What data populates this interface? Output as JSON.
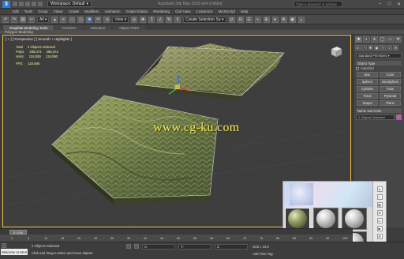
{
  "titlebar": {
    "app_logo": "3",
    "workspace_label": "Workspace: Default",
    "document_title": "Autodesk 3ds Max  2015 x64   Untitled",
    "search_placeholder": "Type a keyword or phrase"
  },
  "menubar": {
    "items": [
      "Edit",
      "Tools",
      "Group",
      "Views",
      "Create",
      "Modifiers",
      "Animation",
      "Graph Editors",
      "Rendering",
      "Civil View",
      "Customize",
      "MAXScript",
      "Help"
    ]
  },
  "toolbar": {
    "selection_filter": "All",
    "view_select": "View",
    "selection_set": "Create Selection Se"
  },
  "ribbon": {
    "tabs": [
      "Graphite Modeling Tools",
      "Freeform",
      "Selection",
      "Object Paint"
    ],
    "active_tab": "Graphite Modeling Tools",
    "strip_label": "Polygon Modeling"
  },
  "viewport": {
    "label": "[ + ] [ Perspective ] [ Smooth + Highlights ]",
    "stats": {
      "total_label": "Total",
      "total_value": "2 Objects Selected",
      "polys_label": "Polys:",
      "polys_values": [
        "268,474",
        "268,474"
      ],
      "verts_label": "Verts:",
      "verts_values": [
        "134,080",
        "134,080"
      ],
      "fps_label": "FPS:",
      "fps_value": "118.590"
    },
    "watermark": "www.cg-ku.com"
  },
  "command_panel": {
    "dropdown": "Standard Primitives",
    "object_type_label": "Object Type",
    "autogrid_label": "AutoGrid",
    "objects": [
      "Box",
      "Cone",
      "Sphere",
      "GeoSphere",
      "Cylinder",
      "Tube",
      "Torus",
      "Pyramid",
      "Teapot",
      "Plane"
    ],
    "name_color_label": "Name and Color",
    "name_value": "2 Objects Selected",
    "swatch_color": "#d84bc6"
  },
  "timeline": {
    "slider_label": "0 / 100",
    "tick_labels": [
      "0",
      "5",
      "10",
      "15",
      "20",
      "25",
      "30",
      "35",
      "40",
      "45",
      "50",
      "55",
      "60",
      "65",
      "70",
      "75",
      "80",
      "85",
      "90",
      "95",
      "100"
    ]
  },
  "statusbar": {
    "maxscript_label": "Welcome to MAX",
    "status_top": "2 Objects Selected",
    "status_bottom": "Click and drag to select and move objects",
    "coord_x": "X:",
    "coord_y": "Y:",
    "coord_z": "Z:",
    "grid_label": "Grid = 10.0",
    "time_tag": "Add Time Tag"
  },
  "colors": {
    "viewport_border": "#f0c040",
    "watermark": "#f2e84a",
    "stats_text": "#f4f4a0",
    "accent": "#2f6fb8"
  }
}
